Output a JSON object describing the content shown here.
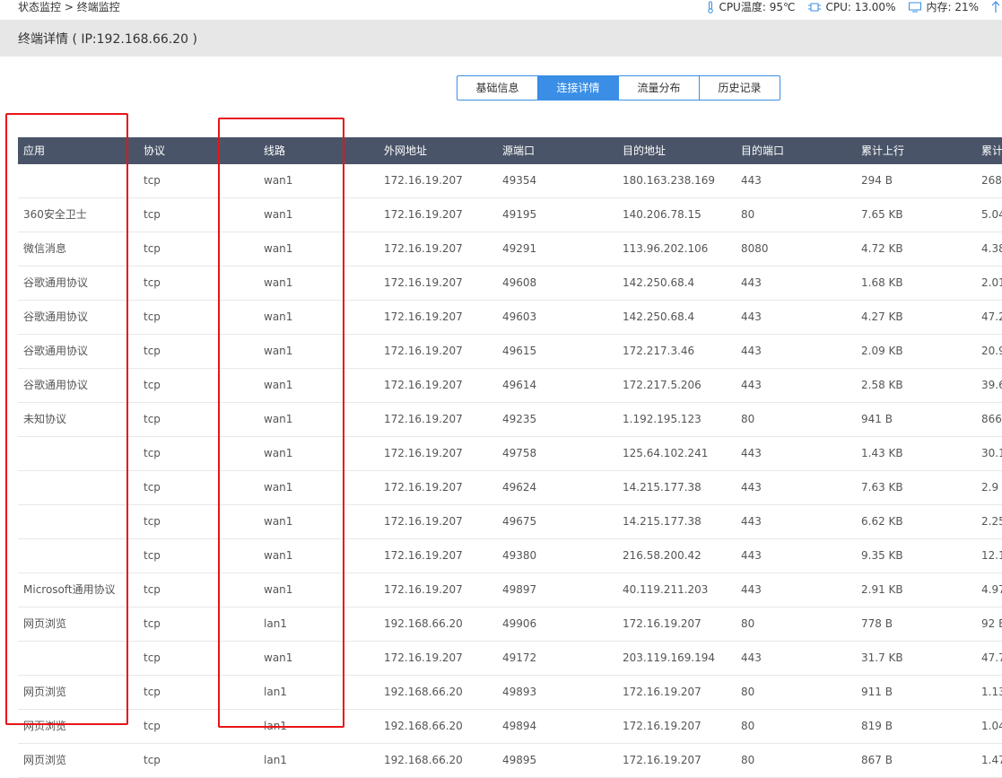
{
  "breadcrumb": {
    "parent": "状态监控",
    "separator": ">",
    "current": "终端监控"
  },
  "status": {
    "cpu_temp_label": "CPU温度: 95℃",
    "cpu_label": "CPU: 13.00%",
    "mem_label": "内存: 21%"
  },
  "header": {
    "title": "终端详情 ( IP:192.168.66.20 )"
  },
  "tabs": [
    {
      "label": "基础信息",
      "active": false
    },
    {
      "label": "连接详情",
      "active": true
    },
    {
      "label": "流量分布",
      "active": false
    },
    {
      "label": "历史记录",
      "active": false
    }
  ],
  "table": {
    "columns": [
      "应用",
      "协议",
      "线路",
      "外网地址",
      "源端口",
      "目的地址",
      "目的端口",
      "累计上行",
      "累计"
    ],
    "rows": [
      [
        "",
        "tcp",
        "wan1",
        "172.16.19.207",
        "49354",
        "180.163.238.169",
        "443",
        "294 B",
        "268"
      ],
      [
        "360安全卫士",
        "tcp",
        "wan1",
        "172.16.19.207",
        "49195",
        "140.206.78.15",
        "80",
        "7.65 KB",
        "5.04"
      ],
      [
        "微信消息",
        "tcp",
        "wan1",
        "172.16.19.207",
        "49291",
        "113.96.202.106",
        "8080",
        "4.72 KB",
        "4.38"
      ],
      [
        "谷歌通用协议",
        "tcp",
        "wan1",
        "172.16.19.207",
        "49608",
        "142.250.68.4",
        "443",
        "1.68 KB",
        "2.01"
      ],
      [
        "谷歌通用协议",
        "tcp",
        "wan1",
        "172.16.19.207",
        "49603",
        "142.250.68.4",
        "443",
        "4.27 KB",
        "47.2"
      ],
      [
        "谷歌通用协议",
        "tcp",
        "wan1",
        "172.16.19.207",
        "49615",
        "172.217.3.46",
        "443",
        "2.09 KB",
        "20.9"
      ],
      [
        "谷歌通用协议",
        "tcp",
        "wan1",
        "172.16.19.207",
        "49614",
        "172.217.5.206",
        "443",
        "2.58 KB",
        "39.6"
      ],
      [
        "未知协议",
        "tcp",
        "wan1",
        "172.16.19.207",
        "49235",
        "1.192.195.123",
        "80",
        "941 B",
        "866"
      ],
      [
        "",
        "tcp",
        "wan1",
        "172.16.19.207",
        "49758",
        "125.64.102.241",
        "443",
        "1.43 KB",
        "30.1"
      ],
      [
        "",
        "tcp",
        "wan1",
        "172.16.19.207",
        "49624",
        "14.215.177.38",
        "443",
        "7.63 KB",
        "2.9 I"
      ],
      [
        "",
        "tcp",
        "wan1",
        "172.16.19.207",
        "49675",
        "14.215.177.38",
        "443",
        "6.62 KB",
        "2.25"
      ],
      [
        "",
        "tcp",
        "wan1",
        "172.16.19.207",
        "49380",
        "216.58.200.42",
        "443",
        "9.35 KB",
        "12.1"
      ],
      [
        "Microsoft通用协议",
        "tcp",
        "wan1",
        "172.16.19.207",
        "49897",
        "40.119.211.203",
        "443",
        "2.91 KB",
        "4.97"
      ],
      [
        "网页浏览",
        "tcp",
        "lan1",
        "192.168.66.20",
        "49906",
        "172.16.19.207",
        "80",
        "778 B",
        "92 E"
      ],
      [
        "",
        "tcp",
        "wan1",
        "172.16.19.207",
        "49172",
        "203.119.169.194",
        "443",
        "31.7 KB",
        "47.7"
      ],
      [
        "网页浏览",
        "tcp",
        "lan1",
        "192.168.66.20",
        "49893",
        "172.16.19.207",
        "80",
        "911 B",
        "1.13"
      ],
      [
        "网页浏览",
        "tcp",
        "lan1",
        "192.168.66.20",
        "49894",
        "172.16.19.207",
        "80",
        "819 B",
        "1.04"
      ],
      [
        "网页浏览",
        "tcp",
        "lan1",
        "192.168.66.20",
        "49895",
        "172.16.19.207",
        "80",
        "867 B",
        "1.47"
      ]
    ]
  },
  "colors": {
    "tab_active": "#3a8ee6",
    "table_header": "#4a5468",
    "highlight_box": "#e8141a"
  }
}
